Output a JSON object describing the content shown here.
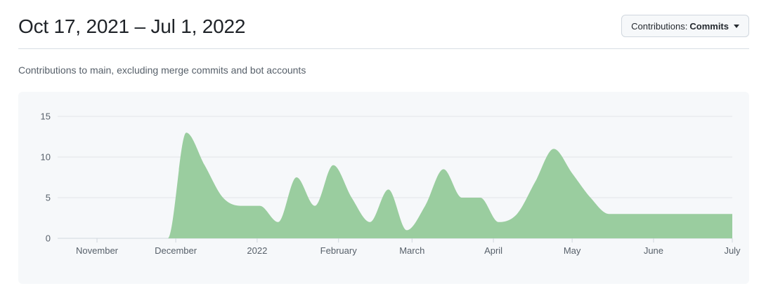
{
  "header": {
    "title": "Oct 17, 2021 – Jul 1, 2022",
    "select_label": "Contributions:",
    "select_value": "Commits"
  },
  "subtitle": "Contributions to main, excluding merge commits and bot accounts",
  "chart_data": {
    "type": "area",
    "title": "",
    "xlabel": "",
    "ylabel": "",
    "ylim": [
      0,
      15
    ],
    "yticks": [
      0,
      5,
      10,
      15
    ],
    "x_axis_type": "date",
    "xlim": [
      "2021-10-17",
      "2022-07-01"
    ],
    "xtick_labels": [
      "November",
      "December",
      "2022",
      "February",
      "March",
      "April",
      "May",
      "June",
      "July"
    ],
    "xtick_dates": [
      "2021-11-01",
      "2021-12-01",
      "2022-01-01",
      "2022-02-01",
      "2022-03-01",
      "2022-04-01",
      "2022-05-01",
      "2022-06-01",
      "2022-07-01"
    ],
    "grid": true,
    "color": "#9acd9f",
    "series": [
      {
        "x": [
          "2021-10-17",
          "2021-10-24",
          "2021-10-31",
          "2021-11-07",
          "2021-11-14",
          "2021-11-21",
          "2021-11-28",
          "2021-12-05",
          "2021-12-12",
          "2021-12-19",
          "2021-12-26",
          "2022-01-02",
          "2022-01-09",
          "2022-01-16",
          "2022-01-23",
          "2022-01-30",
          "2022-02-06",
          "2022-02-13",
          "2022-02-20",
          "2022-02-27",
          "2022-03-06",
          "2022-03-13",
          "2022-03-20",
          "2022-03-27",
          "2022-04-03",
          "2022-04-10",
          "2022-04-17",
          "2022-04-24",
          "2022-05-01",
          "2022-05-08",
          "2022-05-15",
          "2022-05-22",
          "2022-05-29",
          "2022-06-05",
          "2022-06-12",
          "2022-06-19",
          "2022-06-26",
          "2022-07-01"
        ],
        "values": [
          0,
          0,
          0,
          0,
          0,
          0,
          0,
          13,
          9,
          5,
          4,
          4,
          2,
          7.5,
          4,
          9,
          5,
          2,
          6,
          1,
          4,
          8.5,
          5,
          5,
          2,
          3,
          7,
          11,
          8,
          5,
          3,
          3,
          3,
          3,
          3,
          3,
          3,
          3
        ]
      }
    ]
  }
}
